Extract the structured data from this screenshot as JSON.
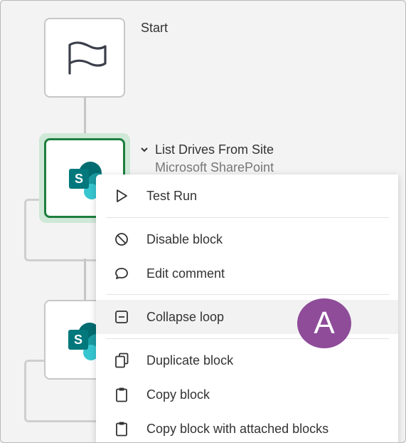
{
  "canvas": {
    "blocks": [
      {
        "title": "Start",
        "icon": "flag-icon"
      },
      {
        "title": "List Drives From Site",
        "subtitle": "Microsoft SharePoint",
        "icon": "sharepoint-icon",
        "expand_icon": "chevron-down-icon"
      },
      {
        "icon": "sharepoint-icon"
      }
    ]
  },
  "context_menu": {
    "items": [
      {
        "label": "Test Run",
        "icon": "play-icon"
      },
      {
        "label": "Disable block",
        "icon": "disable-icon"
      },
      {
        "label": "Edit comment",
        "icon": "comment-icon"
      },
      {
        "label": "Collapse loop",
        "icon": "collapse-icon"
      },
      {
        "label": "Duplicate block",
        "icon": "duplicate-icon"
      },
      {
        "label": "Copy block",
        "icon": "clipboard-icon"
      },
      {
        "label": "Copy block with attached blocks",
        "icon": "clipboard-icon"
      }
    ]
  },
  "annotation": {
    "letter": "A",
    "color": "#8e4c99"
  },
  "colors": {
    "selected_border": "#1e7e3e",
    "sharepoint_teal": "#036c70"
  }
}
